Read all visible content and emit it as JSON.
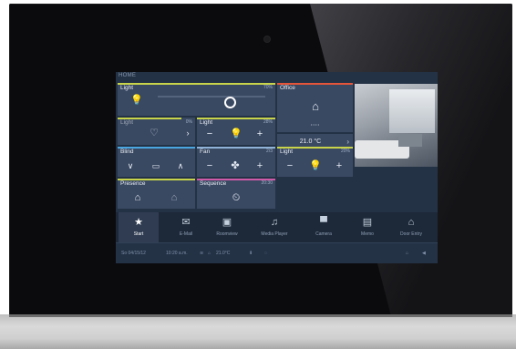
{
  "screen": {
    "home_label": "HOME"
  },
  "tiles": {
    "light_main": {
      "title": "Light",
      "value": "70%",
      "accent": "#c8d44a"
    },
    "office": {
      "title": "Office",
      "value": "",
      "accent": "#e5553a",
      "dots": "• • • •"
    },
    "light_2": {
      "title": "Light",
      "value": "0%",
      "accent": "#c8d44a"
    },
    "light_3": {
      "title": "Light",
      "value": "28%",
      "accent": "#c8d44a"
    },
    "temperature": {
      "value": "21.0 °C"
    },
    "blind": {
      "title": "Blind",
      "value": "",
      "accent": "#4aa6e0"
    },
    "fan": {
      "title": "Fan",
      "value": "2/3",
      "accent": "#8fb2d8"
    },
    "light_4": {
      "title": "Light",
      "value": "20%",
      "accent": "#c8d44a"
    },
    "presence": {
      "title": "Presence",
      "accent": "#c8d44a"
    },
    "sequence": {
      "title": "Sequence",
      "value": "20:30",
      "accent": "#d05aa8"
    }
  },
  "nav": [
    {
      "label": "Start",
      "icon": "star-icon"
    },
    {
      "label": "E-Mail",
      "icon": "mail-icon"
    },
    {
      "label": "Roomview",
      "icon": "room-icon"
    },
    {
      "label": "Media Player",
      "icon": "music-icon"
    },
    {
      "label": "Camera",
      "icon": "camera-icon"
    },
    {
      "label": "Memo",
      "icon": "memo-icon"
    },
    {
      "label": "Door Entry",
      "icon": "door-icon"
    }
  ],
  "status": {
    "date": "So 04/15/12",
    "time": "10:20 a.m.",
    "temperature": "21.0°C"
  },
  "colors": {
    "screen_bg": "#243246",
    "tile_bg": "#3a4962",
    "nav_bg": "#1d2838"
  }
}
